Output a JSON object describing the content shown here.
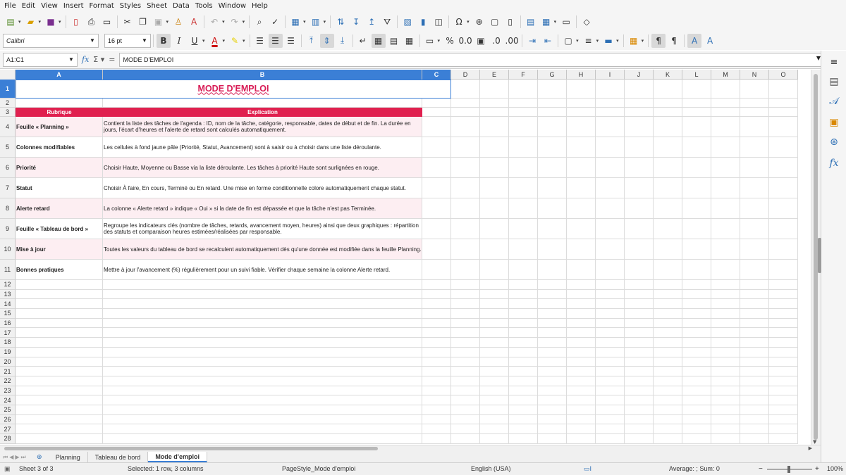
{
  "menu": [
    "File",
    "Edit",
    "View",
    "Insert",
    "Format",
    "Styles",
    "Sheet",
    "Data",
    "Tools",
    "Window",
    "Help"
  ],
  "toolbar": {
    "font_name": "Calibri",
    "font_size": "16 pt",
    "standard_icons": [
      "new-icon",
      "open-icon",
      "save-icon",
      "export-pdf-icon",
      "print-icon",
      "print-preview-icon",
      "cut-icon",
      "copy-icon",
      "paste-icon",
      "clone-formatting-icon",
      "clear-formatting-icon",
      "undo-icon",
      "redo-icon",
      "find-replace-icon",
      "spellcheck-icon",
      "row-icon",
      "column-icon",
      "sort-icon",
      "sort-ascending-icon",
      "sort-descending-icon",
      "autofilter-icon",
      "insert-image-icon",
      "insert-chart-icon",
      "pivot-table-icon",
      "special-character-icon",
      "hyperlink-icon",
      "comment-icon",
      "headers-footers-icon",
      "define-print-area-icon",
      "freeze-rows-columns-icon",
      "split-window-icon",
      "show-draw-functions-icon"
    ],
    "format_icons": [
      "bold-icon",
      "italic-icon",
      "underline-icon",
      "font-color-icon",
      "highlight-icon",
      "align-left-icon",
      "align-center-icon",
      "align-right-icon",
      "align-top-icon",
      "center-vertically-icon",
      "align-bottom-icon",
      "wrap-text-icon",
      "merge-center-icon",
      "merge-cells-icon",
      "unmerge-cells-icon",
      "currency-icon",
      "percent-icon",
      "number-format-icon",
      "date-icon",
      "add-decimal-icon",
      "delete-decimal-icon",
      "increase-indent-icon",
      "decrease-indent-icon",
      "borders-icon",
      "border-style-icon",
      "border-color-icon",
      "conditional-format-icon",
      "left-to-right-icon",
      "right-to-left-icon",
      "text-direction-ltr-icon",
      "text-direction-ttb-icon"
    ]
  },
  "formula_bar": {
    "name_box": "A1:C1",
    "content": "MODE D'EMPLOI"
  },
  "columns": [
    {
      "label": "A",
      "selected": true
    },
    {
      "label": "B",
      "selected": true
    },
    {
      "label": "C",
      "selected": true
    },
    {
      "label": "D",
      "selected": false
    },
    {
      "label": "E",
      "selected": false
    },
    {
      "label": "F",
      "selected": false
    },
    {
      "label": "G",
      "selected": false
    },
    {
      "label": "H",
      "selected": false
    },
    {
      "label": "I",
      "selected": false
    },
    {
      "label": "J",
      "selected": false
    },
    {
      "label": "K",
      "selected": false
    },
    {
      "label": "L",
      "selected": false
    },
    {
      "label": "M",
      "selected": false
    },
    {
      "label": "N",
      "selected": false
    },
    {
      "label": "O",
      "selected": false
    }
  ],
  "sheet": {
    "title": "MODE D'EMPLOI",
    "header": {
      "rubrique": "Rubrique",
      "explication": "Explication"
    },
    "rows": [
      {
        "row": "4",
        "rubrique": "Feuille « Planning »",
        "explication": "Contient la liste des tâches de l'agenda : ID, nom de la tâche, catégorie, responsable, dates de début et de fin. La durée en jours, l'écart d'heures et l'alerte de retard sont calculés automatiquement."
      },
      {
        "row": "5",
        "rubrique": "Colonnes modifiables",
        "explication": "Les cellules à fond jaune pâle (Priorité, Statut, Avancement) sont à saisir ou à choisir dans une liste déroulante."
      },
      {
        "row": "6",
        "rubrique": "Priorité",
        "explication": "Choisir Haute, Moyenne ou Basse via la liste déroulante. Les tâches à priorité Haute sont surlignées en rouge."
      },
      {
        "row": "7",
        "rubrique": "Statut",
        "explication": "Choisir À faire, En cours, Terminé ou En retard. Une mise en forme conditionnelle colore automatiquement chaque statut."
      },
      {
        "row": "8",
        "rubrique": "Alerte retard",
        "explication": "La colonne « Alerte retard » indique « Oui » si la date de fin est dépassée et que la tâche n'est pas Terminée."
      },
      {
        "row": "9",
        "rubrique": "Feuille « Tableau de bord »",
        "explication": "Regroupe les indicateurs clés (nombre de tâches, retards, avancement moyen, heures) ainsi que deux graphiques : répartition des statuts et comparaison heures estimées/réalisées par responsable."
      },
      {
        "row": "10",
        "rubrique": "Mise à jour",
        "explication": "Toutes les valeurs du tableau de bord se recalculent automatiquement dès qu'une donnée est modifiée dans la feuille Planning."
      },
      {
        "row": "11",
        "rubrique": "Bonnes pratiques",
        "explication": "Mettre à jour l'avancement (%) régulièrement pour un suivi fiable. Vérifier chaque semaine la colonne Alerte retard."
      }
    ],
    "empty_rows": [
      "12",
      "13",
      "14",
      "15",
      "16",
      "17",
      "18",
      "19",
      "20",
      "21",
      "22",
      "23",
      "24",
      "25",
      "26",
      "27",
      "28"
    ]
  },
  "tabs": [
    {
      "label": "Planning",
      "active": false
    },
    {
      "label": "Tableau de bord",
      "active": false
    },
    {
      "label": "Mode d'emploi",
      "active": true
    }
  ],
  "status": {
    "sheet": "Sheet 3 of 3",
    "selection": "Selected: 1 row, 3 columns",
    "page_style": "PageStyle_Mode d'emploi",
    "language": "English (USA)",
    "sum": "Average: ; Sum: 0",
    "zoom": "100%"
  },
  "sidebar": [
    "properties-icon",
    "styles-icon",
    "gallery-icon",
    "navigator-icon",
    "functions-icon"
  ],
  "colors": {
    "accent": "#e0204f",
    "title": "#d81b55",
    "selection": "#3b7fd6",
    "row_tint": "#fdeef2"
  }
}
